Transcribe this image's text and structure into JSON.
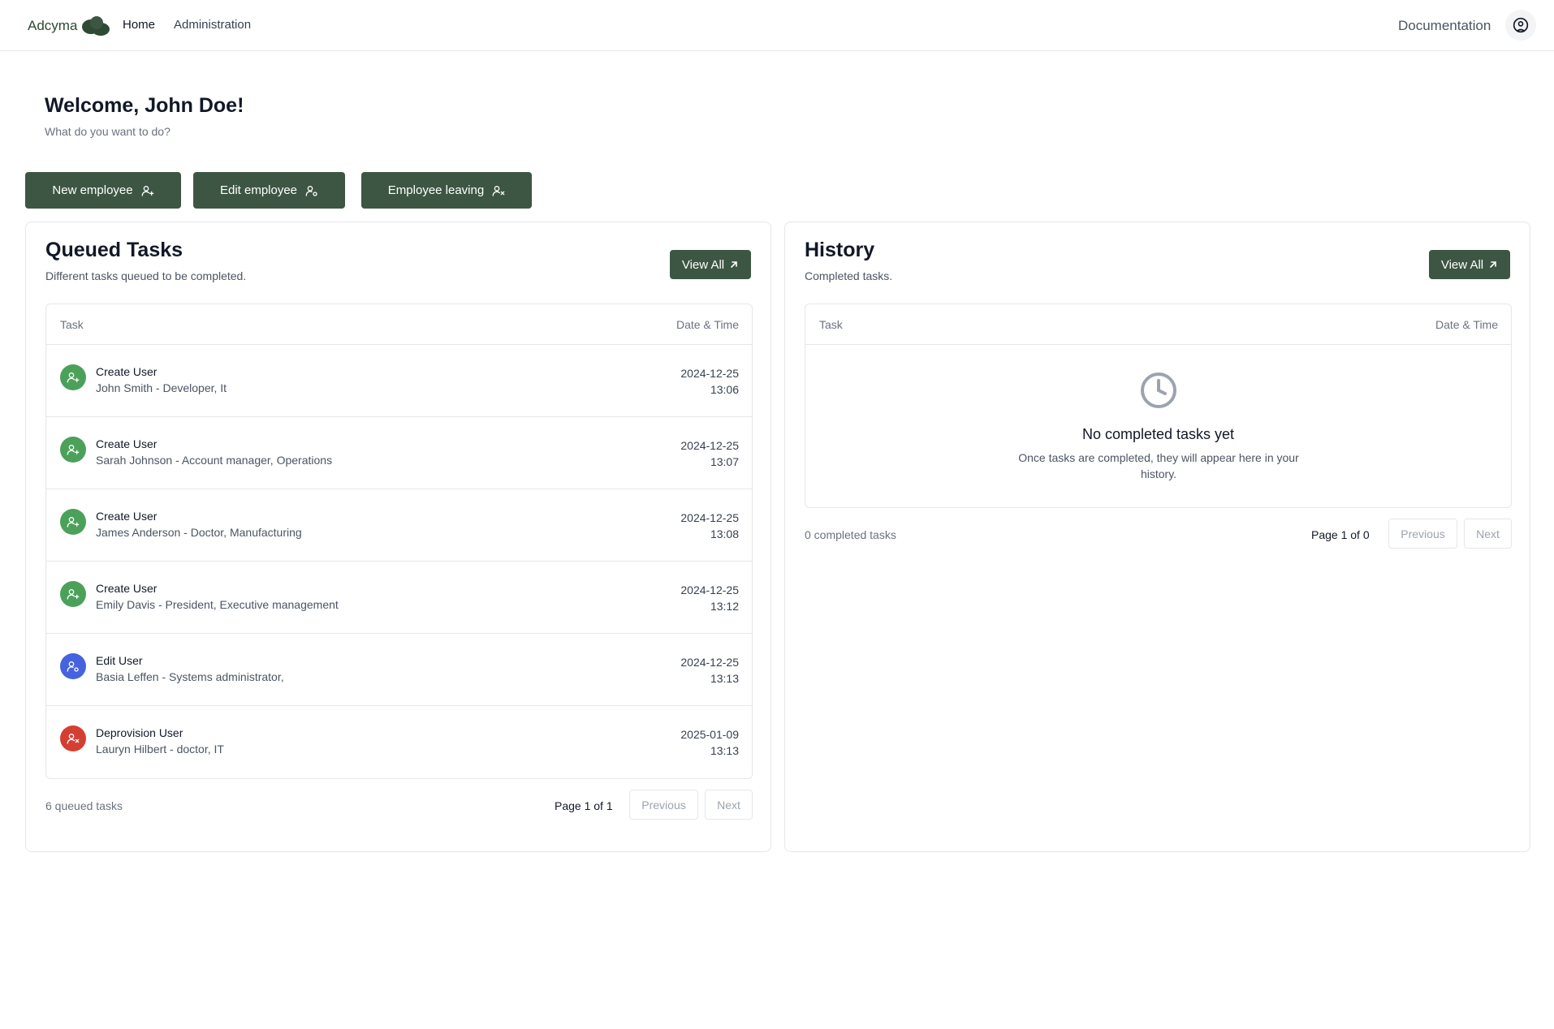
{
  "header": {
    "brand": "Adcyma",
    "nav": {
      "home": "Home",
      "administration": "Administration",
      "documentation": "Documentation"
    }
  },
  "welcome": {
    "title": "Welcome, John Doe!",
    "subtitle": "What do you want to do?"
  },
  "actions": {
    "new_employee": "New employee",
    "edit_employee": "Edit employee",
    "employee_leaving": "Employee leaving"
  },
  "queued": {
    "title": "Queued Tasks",
    "subtitle": "Different tasks queued to be completed.",
    "view_all": "View All",
    "col_task": "Task",
    "col_date": "Date & Time",
    "rows": [
      {
        "title": "Create User",
        "desc": "John Smith - Developer, It",
        "date": "2024-12-25",
        "time": "13:06",
        "kind": "create",
        "color": "#4ca15a"
      },
      {
        "title": "Create User",
        "desc": "Sarah Johnson - Account manager, Operations",
        "date": "2024-12-25",
        "time": "13:07",
        "kind": "create",
        "color": "#4ca15a"
      },
      {
        "title": "Create User",
        "desc": "James Anderson - Doctor, Manufacturing",
        "date": "2024-12-25",
        "time": "13:08",
        "kind": "create",
        "color": "#4ca15a"
      },
      {
        "title": "Create User",
        "desc": "Emily Davis - President, Executive management",
        "date": "2024-12-25",
        "time": "13:12",
        "kind": "create",
        "color": "#4ca15a"
      },
      {
        "title": "Edit User",
        "desc": "Basia Leffen - Systems administrator,",
        "date": "2024-12-25",
        "time": "13:13",
        "kind": "edit",
        "color": "#4563de"
      },
      {
        "title": "Deprovision User",
        "desc": "Lauryn Hilbert - doctor, IT",
        "date": "2025-01-09",
        "time": "13:13",
        "kind": "deprovision",
        "color": "#d43f33"
      }
    ],
    "count_text": "6 queued tasks",
    "page_text": "Page 1 of 1",
    "previous": "Previous",
    "next": "Next"
  },
  "history": {
    "title": "History",
    "subtitle": "Completed tasks.",
    "view_all": "View All",
    "col_task": "Task",
    "col_date": "Date & Time",
    "empty_title": "No completed tasks yet",
    "empty_desc": "Once tasks are completed, they will appear here in your history.",
    "count_text": "0 completed tasks",
    "page_text": "Page 1 of 0",
    "previous": "Previous",
    "next": "Next"
  },
  "colors": {
    "primary": "#3d5643",
    "create": "#4ca15a",
    "edit": "#4563de",
    "deprovision": "#d43f33"
  }
}
